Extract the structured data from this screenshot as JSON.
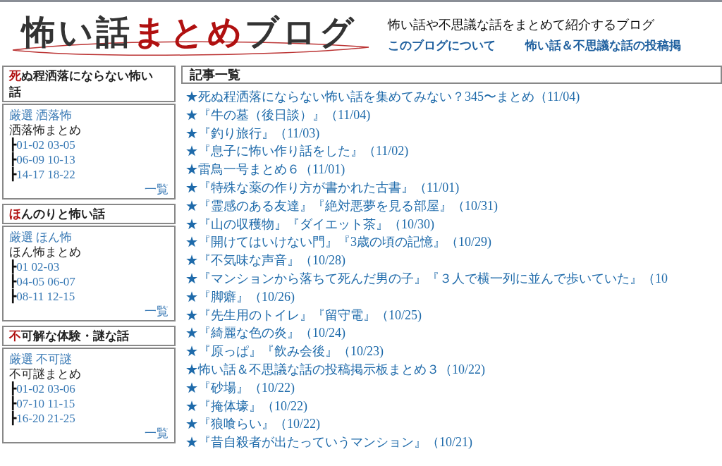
{
  "header": {
    "logo": [
      {
        "text": "怖い話",
        "accent": false
      },
      {
        "text": "まとめ",
        "accent": true
      },
      {
        "text": "ブログ",
        "accent": false
      }
    ],
    "tagline": "怖い話や不思議な話をまとめて紹介するブログ",
    "nav": [
      "このブログについて",
      "怖い話＆不思議な話の投稿掲"
    ]
  },
  "sidebar": [
    {
      "title_initial": "死",
      "title_rest": "ぬ程洒落にならない怖い話",
      "pick": "厳選 洒落怖",
      "summary": "洒落怖まとめ",
      "ranges": [
        "01-02 03-05",
        "06-09 10-13",
        "14-17 18-22"
      ],
      "tree_mark": "┣",
      "more": "一覧"
    },
    {
      "title_initial": "ほ",
      "title_rest": "んのりと怖い話",
      "pick": "厳選 ほん怖",
      "summary": "ほん怖まとめ",
      "ranges": [
        "01 02-03",
        "04-05 06-07",
        "08-11 12-15"
      ],
      "tree_mark": "┣",
      "more": "一覧"
    },
    {
      "title_initial": "不",
      "title_rest": "可解な体験・謎な話",
      "pick": "厳選 不可謎",
      "summary": "不可謎まとめ",
      "ranges": [
        "01-02 03-06",
        "07-10 11-15",
        "16-20 21-25"
      ],
      "tree_mark": "┣",
      "more": "一覧"
    }
  ],
  "articles": {
    "title": "記事一覧",
    "items": [
      "★死ぬ程洒落にならない怖い話を集めてみない？345〜まとめ（11/04)",
      "★『牛の墓（後日談）』（11/04)",
      "★『釣り旅行』（11/03)",
      "★『息子に怖い作り話をした』（11/02)",
      "★雷鳥一号まとめ６（11/01)",
      "★『特殊な薬の作り方が書かれた古書』（11/01)",
      "★『霊感のある友達』『絶対悪夢を見る部屋』（10/31)",
      "★『山の収穫物』『ダイエット茶』（10/30)",
      "★『開けてはいけない門』『3歳の頃の記憶』（10/29)",
      "★『不気味な声音』（10/28)",
      "★『マンションから落ちて死んだ男の子』『３人で横一列に並んで歩いていた』（10",
      "★『脚癖』（10/26)",
      "★『先生用のトイレ』『留守電』（10/25)",
      "★『綺麗な色の炎』（10/24)",
      "★『原っぱ』『飲み会後』（10/23)",
      "★怖い話＆不思議な話の投稿掲示板まとめ３（10/22)",
      "★『砂場』（10/22)",
      "★『掩体壕』（10/22)",
      "★『狼喰らい』（10/22)",
      "★『昔自殺者が出たっていうマンション』（10/21)"
    ]
  }
}
